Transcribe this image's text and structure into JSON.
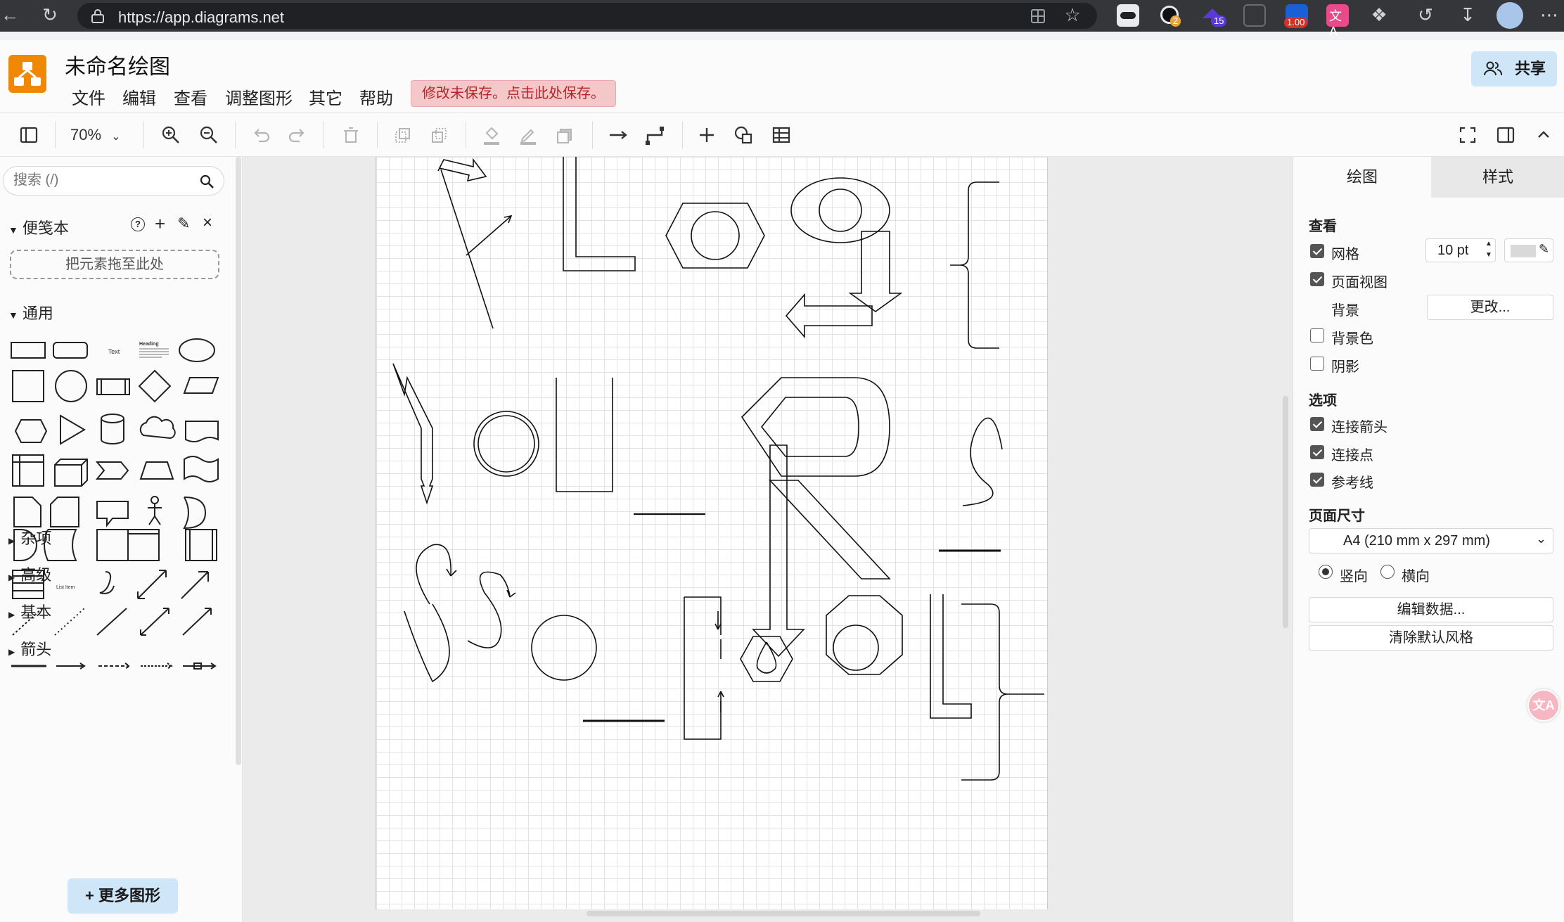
{
  "browser": {
    "url": "https://app.diagrams.net",
    "extensions": [
      {
        "name": "ext-glasses",
        "color": "#202124"
      },
      {
        "name": "ext-circle",
        "color": "#111111",
        "badge": "2",
        "badge_color": "#e8a33d"
      },
      {
        "name": "ext-graduation",
        "color": "#5a3ad6",
        "badge": "15",
        "badge_color": "#5a3ad6"
      },
      {
        "name": "ext-doc",
        "color": "#4a4a4a"
      },
      {
        "name": "ext-flag",
        "color": "#1a5fd6",
        "badge": "1.00",
        "badge_color": "#d93025"
      },
      {
        "name": "ext-translate",
        "color": "#e84a8a"
      }
    ]
  },
  "app": {
    "title": "未命名绘图",
    "menus": [
      "文件",
      "编辑",
      "查看",
      "调整图形",
      "其它",
      "帮助"
    ],
    "unsaved_notice": "修改未保存。点击此处保存。",
    "share_label": "共享"
  },
  "toolbar": {
    "zoom": "70%"
  },
  "left": {
    "search_placeholder": "搜索 (/)",
    "scratchpad_title": "便笺本",
    "dropzone": "把元素拖至此处",
    "general_title": "通用",
    "text_shape": "Text",
    "heading_shape": "Heading",
    "list_item_shape": "List Item",
    "sections": [
      "杂项",
      "高级",
      "基本",
      "箭头"
    ],
    "more_shapes": "更多图形"
  },
  "right": {
    "tabs": [
      "绘图",
      "样式"
    ],
    "view_title": "查看",
    "grid_label": "网格",
    "grid_checked": true,
    "grid_size": "10 pt",
    "grid_color": "#d9d9d9",
    "page_view_label": "页面视图",
    "page_view_checked": true,
    "background_label": "背景",
    "background_btn": "更改...",
    "bgcolor_label": "背景色",
    "bgcolor_checked": false,
    "shadow_label": "阴影",
    "shadow_checked": false,
    "options_title": "选项",
    "options": [
      {
        "label": "连接箭头",
        "checked": true
      },
      {
        "label": "连接点",
        "checked": true
      },
      {
        "label": "参考线",
        "checked": true
      }
    ],
    "page_size_title": "页面尺寸",
    "page_size_value": "A4 (210 mm x 297 mm)",
    "portrait_label": "竖向",
    "landscape_label": "横向",
    "orientation": "portrait",
    "edit_data_btn": "编辑数据...",
    "clear_style_btn": "清除默认风格"
  }
}
